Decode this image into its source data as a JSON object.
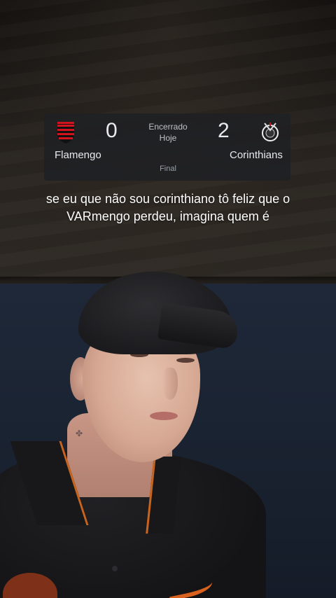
{
  "scoreboard": {
    "home_team": "Flamengo",
    "away_team": "Corinthians",
    "home_score": "0",
    "away_score": "2",
    "status_line1": "Encerrado",
    "status_line2": "Hoje",
    "stage": "Final",
    "home_crest_icon": "flamengo-crest",
    "away_crest_icon": "corinthians-crest",
    "home_colors": [
      "#d3141f",
      "#111111"
    ],
    "away_color": "#ffffff"
  },
  "caption": "se eu que não sou corinthiano tô feliz que o VARmengo perdeu, imagina quem é",
  "colors": {
    "card_bg": "#202124",
    "text_primary": "#e8eaed",
    "text_secondary": "#bdc1c6",
    "shirt_trim": "#c8641e"
  }
}
